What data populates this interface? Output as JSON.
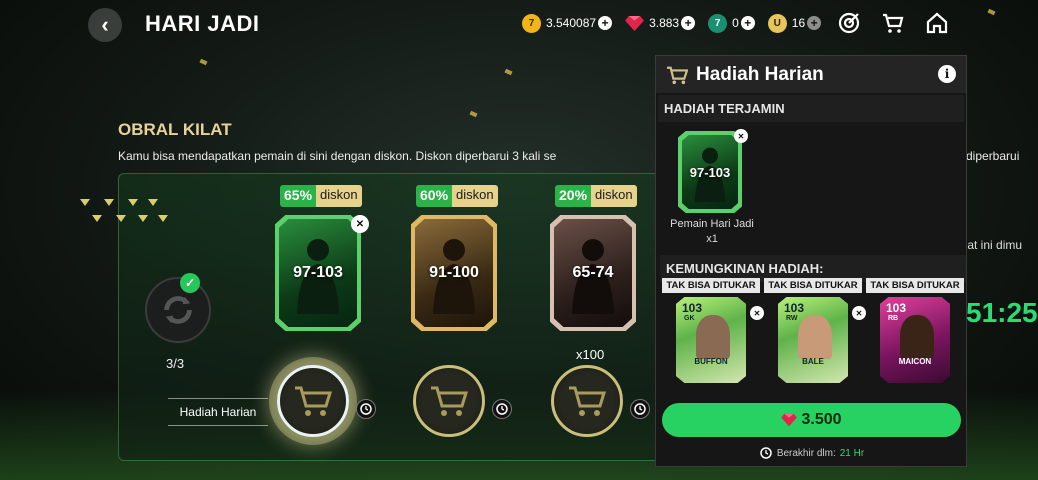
{
  "header": {
    "title": "HARI JADI",
    "back_icon": "chevron-left-icon",
    "currencies": [
      {
        "icon": "coin-icon",
        "glyph": "7",
        "value": "3.540087"
      },
      {
        "icon": "gem-icon",
        "glyph": "",
        "value": "3.883"
      },
      {
        "icon": "token-icon",
        "glyph": "7",
        "value": "0"
      },
      {
        "icon": "u-coin-icon",
        "glyph": "U",
        "value": "16"
      }
    ],
    "icons": [
      "target-icon",
      "cart-icon",
      "home-icon"
    ]
  },
  "section": {
    "title": "OBRAL KILAT",
    "description": "Kamu bisa mendapatkan pemain di sini dengan diskon. Diskon diperbarui 3 kali se",
    "description_right": "diperbarui",
    "side_text": "ilat ini dimu",
    "timer": "51:25"
  },
  "refresh": {
    "count": "3/3",
    "icon": "refresh-icon",
    "check_icon": "check-icon"
  },
  "daily_label": "Hadiah Harian",
  "offers": [
    {
      "discount": "65%",
      "discount_word": "diskon",
      "rating": "97-103",
      "style": "green",
      "untradeable_glyph": "✕"
    },
    {
      "discount": "60%",
      "discount_word": "diskon",
      "rating": "91-100",
      "style": "gold",
      "untradeable_glyph": ""
    },
    {
      "discount": "20%",
      "discount_word": "diskon",
      "rating": "65-74",
      "style": "bronze",
      "untradeable_glyph": "✕",
      "quantity": "x100"
    }
  ],
  "popup": {
    "title": "Hadiah Harian",
    "info_glyph": "i",
    "guaranteed_heading": "HADIAH TERJAMIN",
    "guaranteed": {
      "rating": "97-103",
      "name": "Pemain Hari Jadi",
      "qty": "x1"
    },
    "possible_heading": "KEMUNGKINAN HADIAH:",
    "possible": [
      {
        "tag": "TAK BISA DITUKAR",
        "rating": "103",
        "position": "GK",
        "name": "BUFFON",
        "style": "green"
      },
      {
        "tag": "TAK BISA DITUKAR",
        "rating": "103",
        "position": "RW",
        "name": "BALE",
        "style": "green"
      },
      {
        "tag": "TAK BISA DITUKAR",
        "rating": "103",
        "position": "RB",
        "name": "MAICON",
        "style": "pink"
      }
    ],
    "price": "3.500",
    "expiry_label": "Berakhir dlm:",
    "expiry_value": "21 Hr"
  },
  "colors": {
    "accent_green": "#27d262",
    "gold": "#e8d49a",
    "gem": "#e0244a"
  }
}
